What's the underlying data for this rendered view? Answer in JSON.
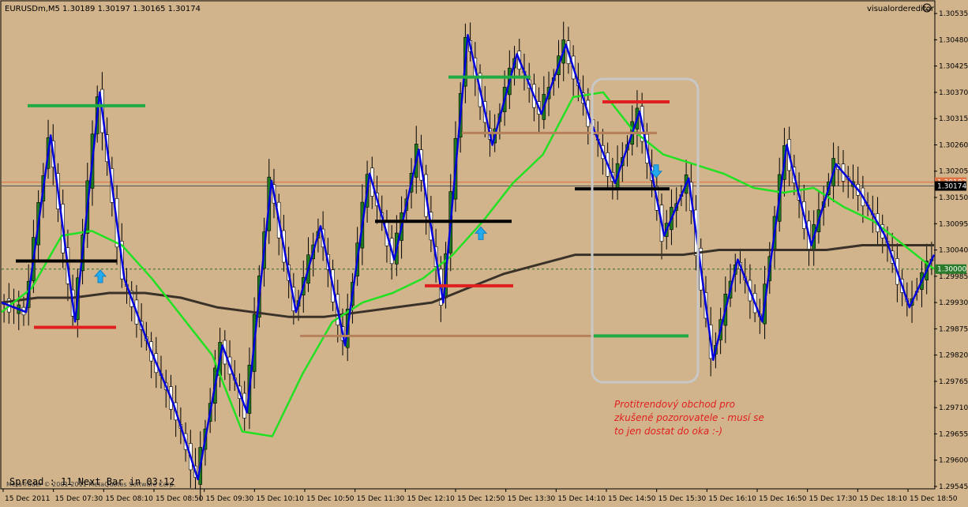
{
  "header": {
    "title": "EURUSDm,M5  1.30189 1.30197 1.30165 1.30174",
    "indicator": "visualordereditor",
    "indicator_icon": "smiley-icon"
  },
  "footer": {
    "spread_text": "Spread : 11  Next  Bar  in  03:12",
    "copyright": "MetaTrader © 2001-2011 MetaQuotes Software Corp."
  },
  "annotation": {
    "lines": [
      "Protitrendový obchod pro",
      "zkušené pozorovatele - musí se",
      "to jen dostat do oka :-)"
    ]
  },
  "colors": {
    "background": "#d2b48c",
    "zigzag": "#0000dd",
    "fast_ma": "#22e022",
    "slow_ma": "#3a3228",
    "bull": "#1f7a1f",
    "bear": "#ffffff",
    "support": "#000000",
    "target": "#22aa44",
    "stop": "#e02020",
    "level": "#b5805a",
    "ask_line": "#e07040",
    "arrow": "#22aaee"
  },
  "chart_data": {
    "type": "candlestick",
    "symbol": "EURUSDm",
    "timeframe": "M5",
    "ohlc": {
      "open": 1.30189,
      "high": 1.30197,
      "low": 1.30165,
      "close": 1.30174
    },
    "ylim": [
      1.2954,
      1.3056
    ],
    "y_ticks": [
      1.30535,
      1.3048,
      1.30425,
      1.3037,
      1.30315,
      1.3026,
      1.30205,
      1.3015,
      1.30095,
      1.3004,
      1.29985,
      1.2993,
      1.29875,
      1.2982,
      1.29765,
      1.2971,
      1.29655,
      1.296,
      1.29545
    ],
    "x_ticks": [
      "15 Dec 2011",
      "15 Dec 07:30",
      "15 Dec 08:10",
      "15 Dec 08:50",
      "15 Dec 09:30",
      "15 Dec 10:10",
      "15 Dec 10:50",
      "15 Dec 11:30",
      "15 Dec 12:10",
      "15 Dec 12:50",
      "15 Dec 13:30",
      "15 Dec 14:10",
      "15 Dec 14:50",
      "15 Dec 15:30",
      "15 Dec 16:10",
      "15 Dec 16:50",
      "15 Dec 17:30",
      "15 Dec 18:10",
      "15 Dec 18:50"
    ],
    "current_price": {
      "value": 1.30174,
      "label": "1.30174"
    },
    "ask_price": {
      "value": 1.30182,
      "label": "1.30182"
    },
    "level_1_30000": {
      "value": 1.3,
      "label": "1.30000"
    },
    "zigzag": [
      1.2993,
      1.2991,
      1.3028,
      1.2989,
      1.3037,
      1.2998,
      1.2984,
      1.29718,
      1.2956,
      1.2984,
      1.297,
      1.30185,
      1.2991,
      1.3009,
      1.2984,
      1.302,
      1.3002,
      1.3025,
      1.2993,
      1.3049,
      1.3026,
      1.3045,
      1.30325,
      1.3047,
      1.3031,
      1.3018,
      1.3033,
      1.3007,
      1.3019,
      1.2981,
      1.3002,
      1.2989,
      1.3026,
      1.3005,
      1.3022,
      1.3016,
      1.3007,
      1.2992,
      1.3003
    ],
    "fast_ma": [
      1.2991,
      1.2996,
      1.3007,
      1.3008,
      1.3005,
      1.2998,
      1.299,
      1.2982,
      1.2966,
      1.2965,
      1.2978,
      1.2989,
      1.2993,
      1.2995,
      1.2998,
      1.3003,
      1.301,
      1.3018,
      1.3024,
      1.3036,
      1.3037,
      1.3029,
      1.3024,
      1.3022,
      1.302,
      1.3017,
      1.3016,
      1.3017,
      1.3013,
      1.301,
      1.3005,
      1.3
    ],
    "slow_ma": [
      1.2993,
      1.2994,
      1.2994,
      1.2995,
      1.2995,
      1.2994,
      1.2992,
      1.2991,
      1.299,
      1.299,
      1.2991,
      1.2992,
      1.2993,
      1.2996,
      1.2999,
      1.3001,
      1.3003,
      1.3003,
      1.3003,
      1.3003,
      1.3004,
      1.3004,
      1.3004,
      1.3004,
      1.3005,
      1.3005,
      1.3005
    ],
    "trade_levels": [
      {
        "kind": "entry",
        "value": 1.30017
      },
      {
        "kind": "target",
        "value": 1.30342
      },
      {
        "kind": "stop",
        "value": 1.29878
      },
      {
        "kind": "target",
        "value": 1.30402
      },
      {
        "kind": "level",
        "value": 1.30285
      },
      {
        "kind": "entry",
        "value": 1.301
      },
      {
        "kind": "stop",
        "value": 1.29965
      },
      {
        "kind": "level",
        "value": 1.2986
      },
      {
        "kind": "stop",
        "value": 1.3035
      },
      {
        "kind": "level",
        "value": 1.30285
      },
      {
        "kind": "entry",
        "value": 1.30168
      },
      {
        "kind": "target",
        "value": 1.2986
      }
    ],
    "arrows": [
      {
        "value": 1.29985
      },
      {
        "value": 1.30075
      },
      {
        "value": 1.30205
      }
    ]
  }
}
